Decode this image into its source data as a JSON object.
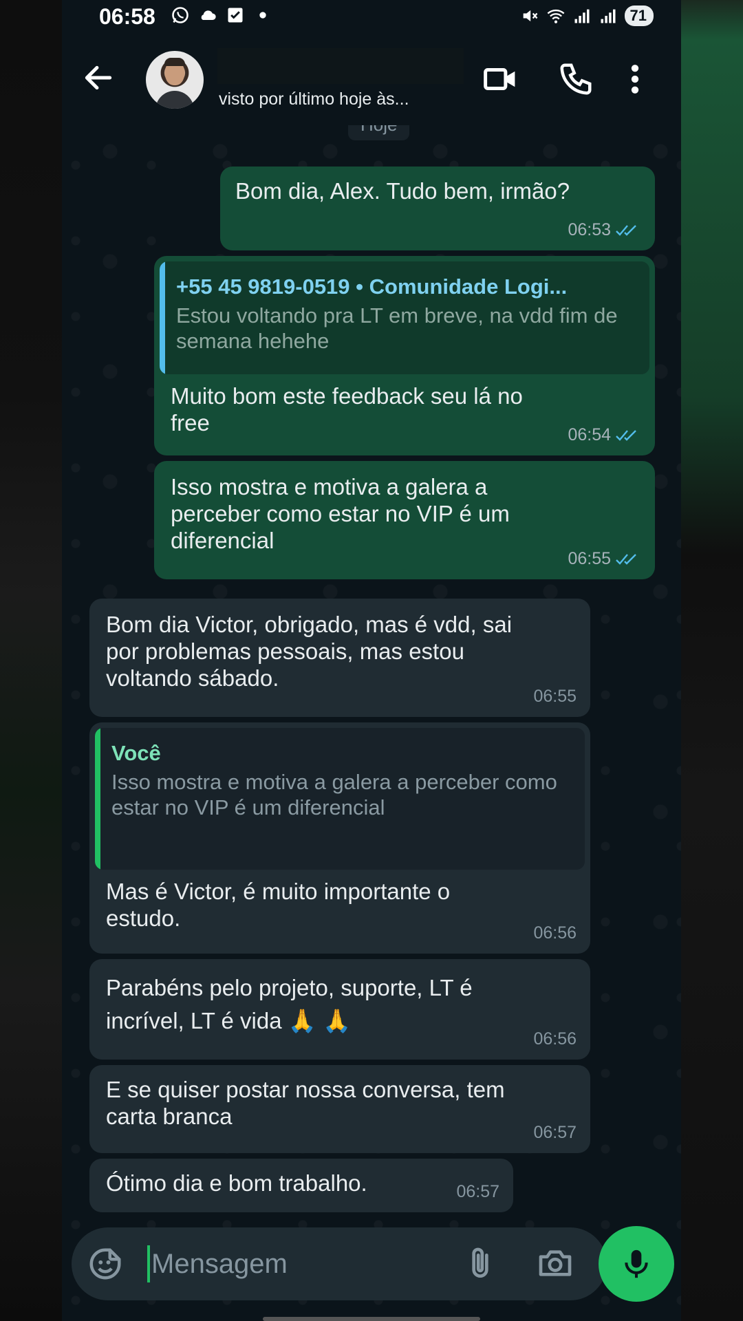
{
  "status_bar": {
    "time": "06:58",
    "battery": "71"
  },
  "header": {
    "last_seen": "visto por último hoje às..."
  },
  "date_chip": "Hoje",
  "messages": [
    {
      "text": "Bom dia, Alex. Tudo bem, irmão?",
      "time": "06:53",
      "direction": "out",
      "status": "read"
    },
    {
      "quote_author": "+55 45 9819-0519 • Comunidade Logi...",
      "quote_text": "Estou voltando pra LT em breve, na vdd fim de semana hehehe",
      "text": "Muito bom este feedback seu lá no free",
      "time": "06:54",
      "direction": "out",
      "status": "read"
    },
    {
      "text": "Isso mostra e motiva a galera a perceber como estar no VIP é um diferencial",
      "time": "06:55",
      "direction": "out",
      "status": "read"
    },
    {
      "text": "Bom dia Victor, obrigado, mas é vdd, sai por problemas pessoais, mas estou voltando sábado.",
      "time": "06:55",
      "direction": "in"
    },
    {
      "quote_author": "Você",
      "quote_text": "Isso mostra e motiva a galera a perceber como estar no VIP é um diferencial",
      "text": "Mas é Victor, é muito importante o estudo.",
      "time": "06:56",
      "direction": "in"
    },
    {
      "text": "Parabéns pelo projeto, suporte, LT é incrível, LT é vida 🙏 🙏",
      "time": "06:56",
      "direction": "in"
    },
    {
      "text": "E se quiser postar nossa conversa, tem carta branca",
      "time": "06:57",
      "direction": "in"
    },
    {
      "text": "Ótimo dia e bom trabalho.",
      "time": "06:57",
      "direction": "in"
    }
  ],
  "composer": {
    "placeholder": "Mensagem"
  },
  "colors": {
    "background": "#0b141a",
    "outgoing_bubble": "#144d37",
    "incoming_bubble": "#202c33",
    "accent_green": "#21c063",
    "read_ticks": "#53bdeb"
  },
  "icons": [
    "back-arrow-icon",
    "video-call-icon",
    "phone-icon",
    "more-vert-icon",
    "sticker-icon",
    "attach-icon",
    "camera-icon",
    "mic-icon"
  ]
}
